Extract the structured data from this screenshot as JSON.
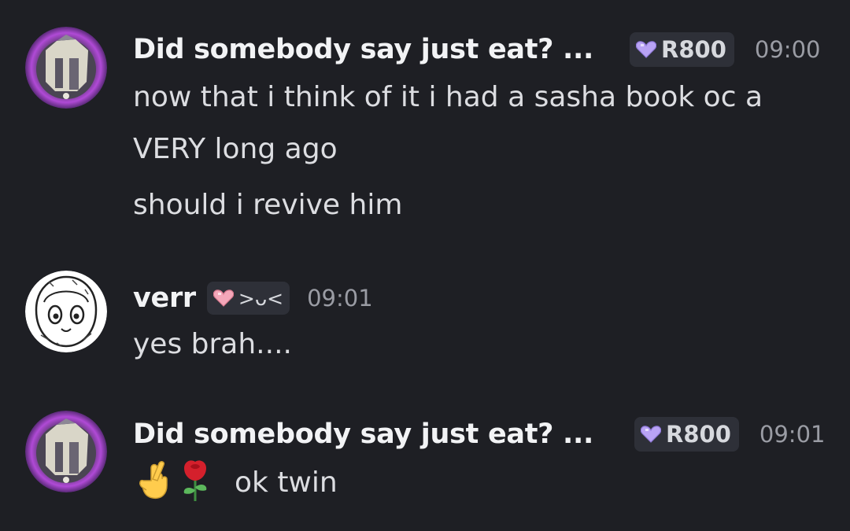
{
  "messages": [
    {
      "username": "Did somebody say just eat? ...",
      "tag": "R800",
      "timestamp": "09:00",
      "lines": [
        "now that i think of it i had a sasha book oc a",
        "VERY long ago",
        "should i revive him"
      ],
      "avatar_icon": "anime-character-avatar",
      "heart_color": "#b9a3f5"
    },
    {
      "username": "verr",
      "tag": ">ᴗ<",
      "timestamp": "09:01",
      "lines": [
        "yes brah...."
      ],
      "avatar_icon": "sketch-character-avatar",
      "heart_color": "#f4a7b9"
    },
    {
      "username": "Did somebody say just eat? ...",
      "tag": "R800",
      "timestamp": "09:01",
      "emojis": [
        "crossed-fingers-emoji",
        "rose-emoji"
      ],
      "text": "ok twin",
      "avatar_icon": "anime-character-avatar",
      "heart_color": "#b9a3f5"
    }
  ]
}
